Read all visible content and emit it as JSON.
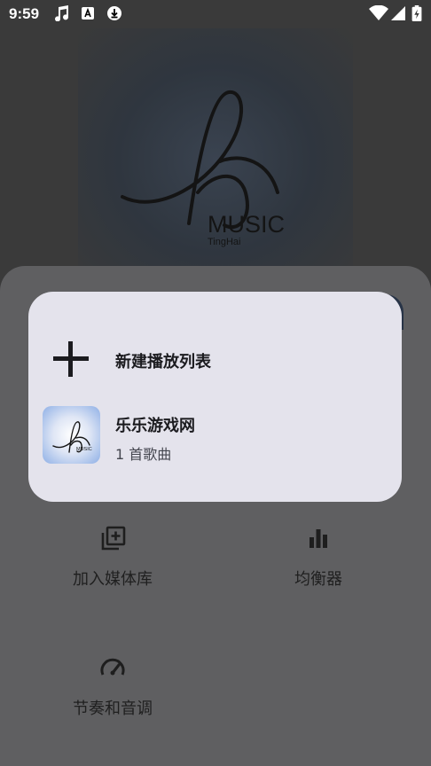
{
  "status_bar": {
    "time": "9:59",
    "icons_left": [
      "music-note-icon",
      "app-store-icon",
      "download-icon"
    ],
    "icons_right": [
      "wifi-icon",
      "signal-icon",
      "battery-charging-icon"
    ]
  },
  "album_art": {
    "brand": "MUSIC",
    "brand_sub": "TingHai"
  },
  "dialog": {
    "new_playlist_label": "新建播放列表",
    "playlist": {
      "name": "乐乐游戏网",
      "count_label": "1 首歌曲",
      "thumb_brand": "MUSIC"
    }
  },
  "sheet": {
    "actions": [
      {
        "label": "加入媒体库",
        "icon": "library-add-icon"
      },
      {
        "label": "均衡器",
        "icon": "equalizer-icon"
      },
      {
        "label": "节奏和音调",
        "icon": "speedometer-icon"
      }
    ]
  },
  "colors": {
    "dialog_bg": "#e4e3ec",
    "sheet_bg": "#5f5f61",
    "scrim": "#3a3a3a"
  }
}
